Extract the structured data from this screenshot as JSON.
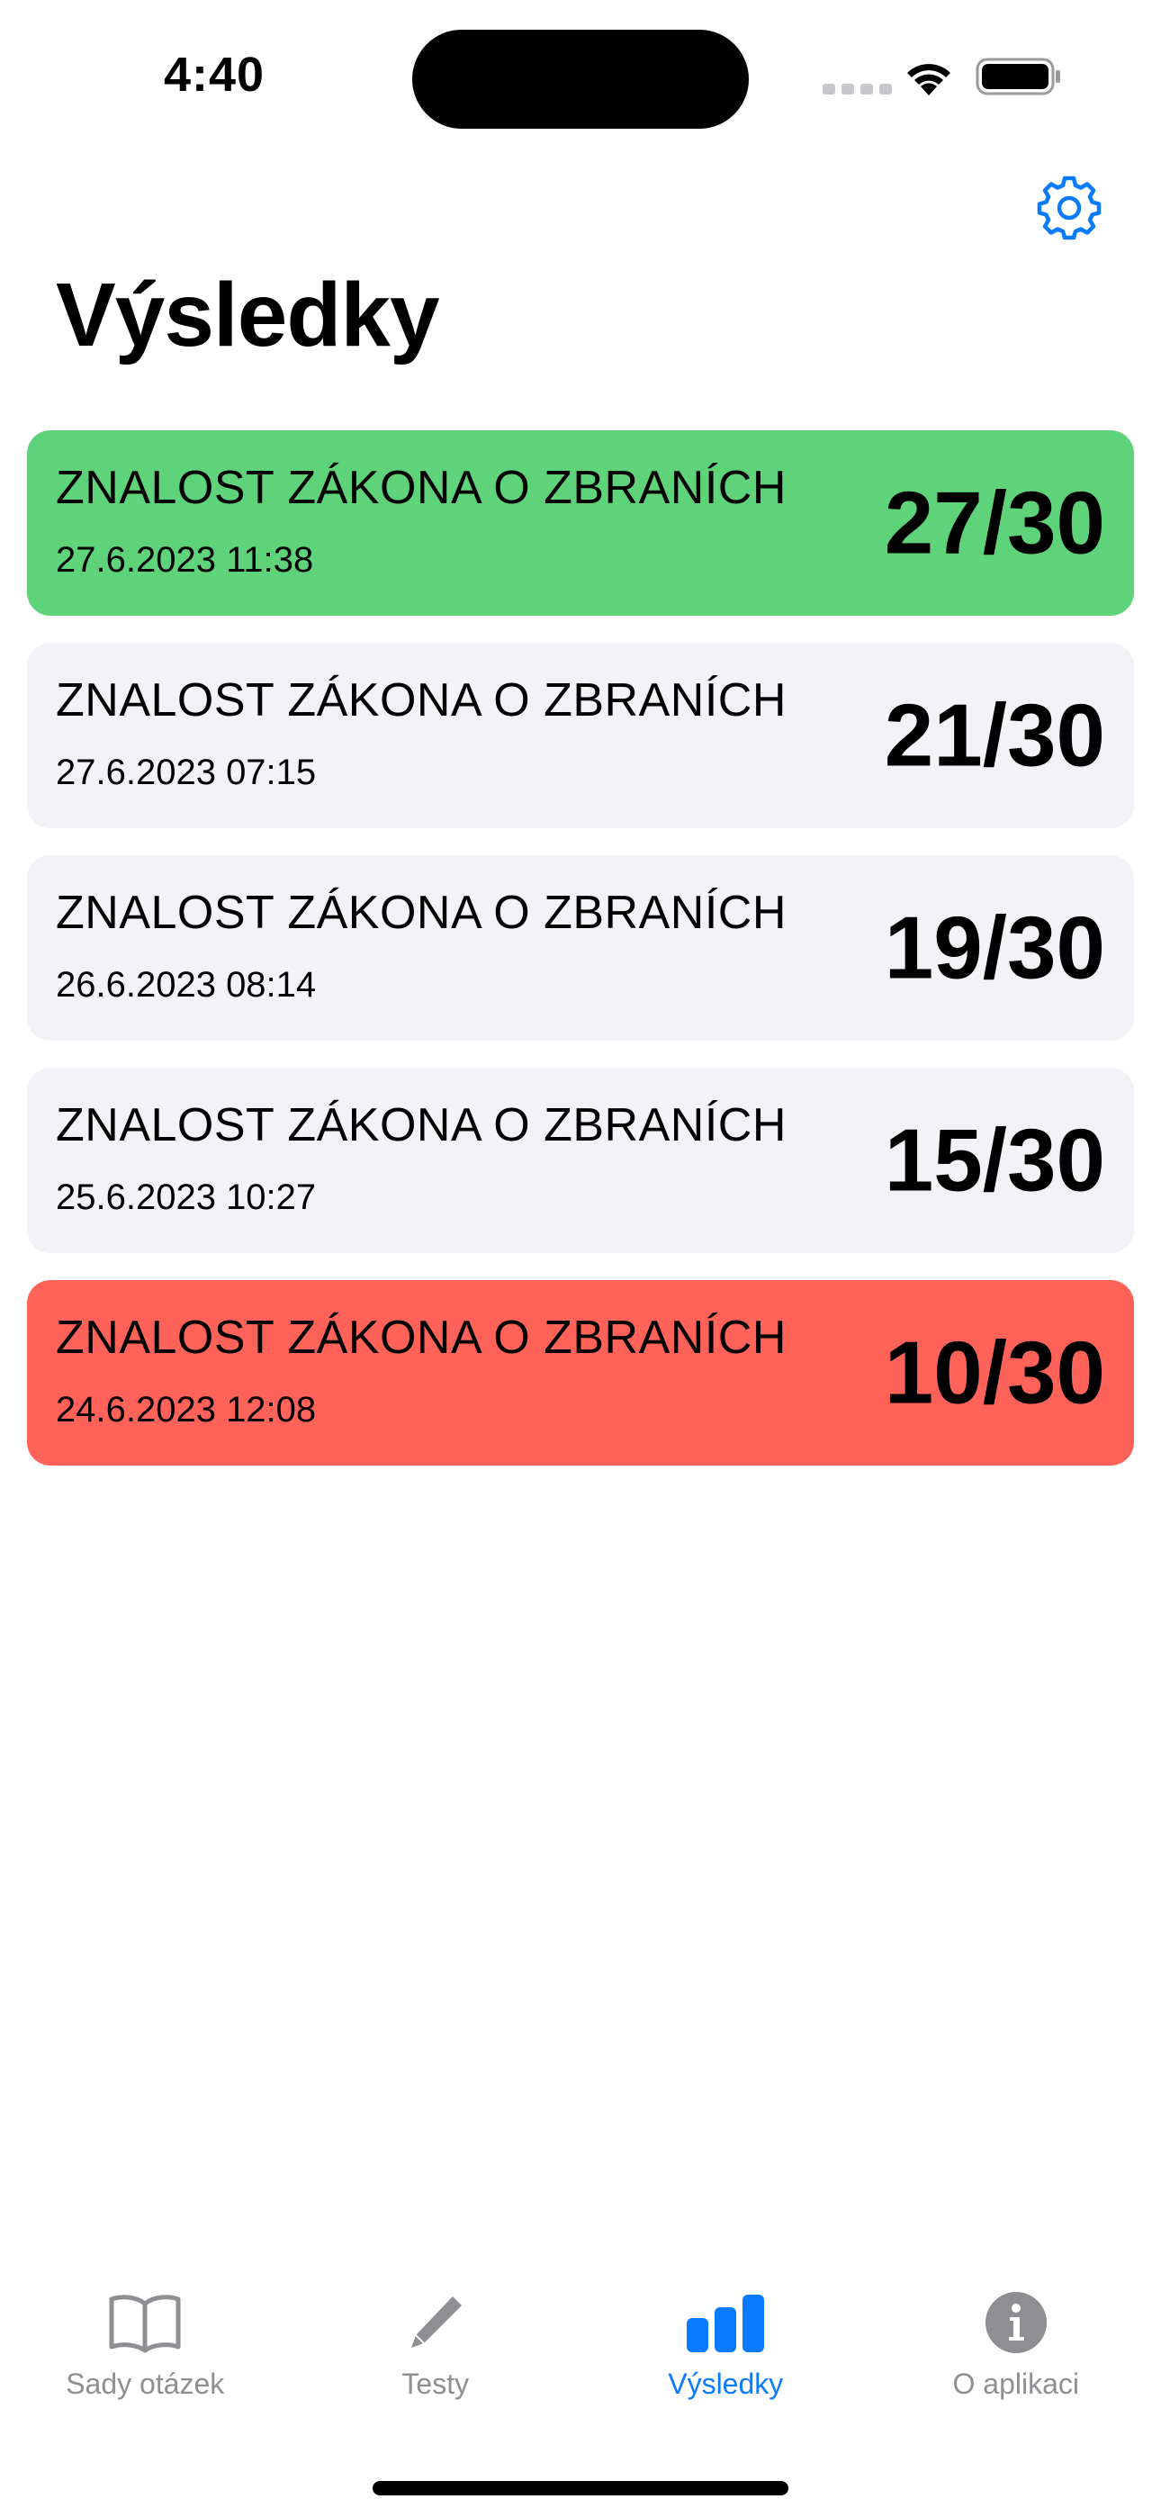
{
  "status_bar": {
    "time": "4:40"
  },
  "header": {
    "title": "Výsledky",
    "settings_icon": "gear-icon"
  },
  "colors": {
    "accent": "#0a7aff",
    "pass": "#5fd37a",
    "fail": "#ff6259",
    "neutral_card": "#f2f2f7",
    "tab_inactive": "#8e8e93"
  },
  "results": [
    {
      "name": "ZNALOST ZÁKONA O ZBRANÍCH",
      "date": "27.6.2023 11:38",
      "score": "27/30",
      "status": "good"
    },
    {
      "name": "ZNALOST ZÁKONA O ZBRANÍCH",
      "date": "27.6.2023 07:15",
      "score": "21/30",
      "status": "neutral"
    },
    {
      "name": "ZNALOST ZÁKONA O ZBRANÍCH",
      "date": "26.6.2023 08:14",
      "score": "19/30",
      "status": "neutral"
    },
    {
      "name": "ZNALOST ZÁKONA O ZBRANÍCH",
      "date": "25.6.2023 10:27",
      "score": "15/30",
      "status": "neutral"
    },
    {
      "name": "ZNALOST ZÁKONA O ZBRANÍCH",
      "date": "24.6.2023 12:08",
      "score": "10/30",
      "status": "bad"
    }
  ],
  "tab_bar": {
    "items": [
      {
        "label": "Sady otázek",
        "icon": "book-icon",
        "active": false
      },
      {
        "label": "Testy",
        "icon": "pencil-icon",
        "active": false
      },
      {
        "label": "Výsledky",
        "icon": "bar-chart-icon",
        "active": true
      },
      {
        "label": "O aplikaci",
        "icon": "info-icon",
        "active": false
      }
    ]
  }
}
